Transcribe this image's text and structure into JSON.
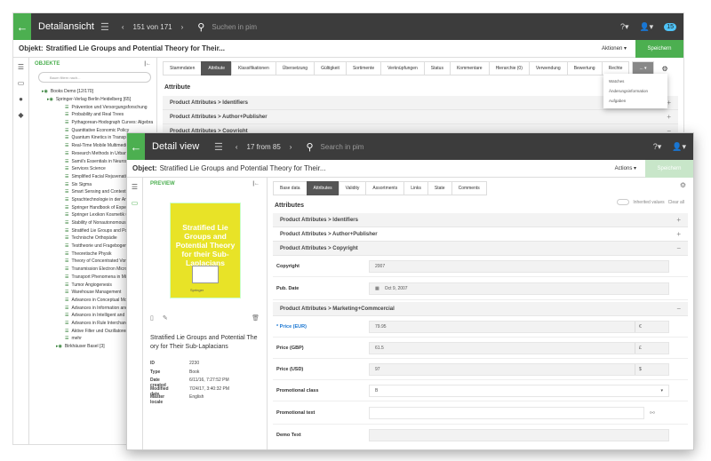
{
  "back_win": {
    "title": "Detailansicht",
    "pager": "151 von 171",
    "search_placeholder": "Suchen in pim",
    "badge": "15",
    "object_label": "Objekt:",
    "object_value": "Stratified Lie Groups and Potential Theory for Their...",
    "actions": "Aktionen ▾",
    "save": "Speichern",
    "tree_title": "OBJEKTE",
    "filter_placeholder": "Baum filtern nach...",
    "tree": [
      "Books Demo [12/170]",
      "Springer-Verlag Berlin Heidelberg [65]",
      "Prävention und Versorgungsforschung",
      "Probability and Real Trees",
      "Pythagorean-Hodograph Curves: Algebra",
      "Quantitative Economic Policy",
      "Quantum Kinetics in Transport",
      "Real-Time Mobile Multimedia",
      "Research Methods in Urban and",
      "Samii's Essentials in Neurosurgery",
      "Services Science",
      "Simplified Facial Rejuvenation",
      "Six Sigma",
      "Smart Sensing and Context",
      "Sprachtechnologie in der Anw",
      "Springer Handbook of Experim",
      "Springer Lexikon Kosmetik und",
      "Stability of Nonautonomous D",
      "Stratified Lie Groups and Pote",
      "Technische Orthopädie",
      "Testtheorie und Fragebogenkon",
      "Theoretische Physik",
      "Theory of Concentrated Vortic",
      "Transmission Electron Microsc",
      "Transport Phenomena in Micr",
      "Tumor Angiogenesis",
      "Warehouse Management",
      "Advances in Conceptual Model",
      "Advances in Information and",
      "Advances in Intelligent and Di",
      "Advances in Rule Interchange",
      "Aktive Filter und Oszillatoren",
      "mehr",
      "Birkhäuser Basel [3]"
    ],
    "tabs": [
      "Stammdaten",
      "Attribute",
      "Klassifikationen",
      "Übersetzung",
      "Gültigkeit",
      "Sortimente",
      "Verknüpfungen",
      "Status",
      "Kommentare",
      "Hierarchie (0)",
      "Verwendung",
      "Bewertung",
      "Rechte",
      "... ▾"
    ],
    "heading": "Attribute",
    "sections": [
      "Product Attributes > Identifiers",
      "Product Attributes > Author+Publisher",
      "Product Attributes > Copyright"
    ],
    "dropdown": [
      "Watches",
      "Änderungsinformation",
      "Aufgaben"
    ],
    "side_hint": "teilen"
  },
  "front_win": {
    "title": "Detail view",
    "pager": "17 from 85",
    "search_placeholder": "Search in pim",
    "object_label": "Object:",
    "object_value": "Stratified Lie Groups and Potential Theory for Their...",
    "actions": "Actions ▾",
    "save": "Speichern",
    "preview": "PREVIEW",
    "cover_title": "Stratified Lie Groups and Potential Theory for their Sub-Laplacians",
    "cover_publisher": "Springer",
    "product_title": "Stratified Lie Groups and Potential The ory for Their Sub-Laplacians",
    "meta": [
      [
        "ID",
        "2230"
      ],
      [
        "Type",
        "Book"
      ],
      [
        "Date created",
        "6/11/16, 7:27:52 PM"
      ],
      [
        "Modified date",
        "7/24/17, 3:40:32 PM"
      ],
      [
        "Master locale",
        "English"
      ]
    ],
    "tabs": [
      "Base data",
      "Attributes",
      "Validity",
      "Assortments",
      "Links",
      "State",
      "Comments"
    ],
    "heading": "Attributes",
    "inherited": "Inherited values",
    "clear": "Clear all",
    "sections": [
      "Product Attributes > Identifiers",
      "Product Attributes > Author+Publisher",
      "Product Attributes > Copyright",
      "Product Attributes > Marketing+Commcercial"
    ],
    "copyright": {
      "label": "Copyright",
      "value": "2007"
    },
    "pubdate": {
      "label": "Pub. Date",
      "value": "Oct 9, 2007"
    },
    "price_eur": {
      "label": "* Price (EUR)",
      "value": "79.95",
      "unit": "€"
    },
    "price_gbp": {
      "label": "Price (GBP)",
      "value": "61.5",
      "unit": "£"
    },
    "price_usd": {
      "label": "Price (USD)",
      "value": "97",
      "unit": "$"
    },
    "promo_class": {
      "label": "Promotional class",
      "value": "B"
    },
    "promo_text": {
      "label": "Promotional text",
      "value": ""
    },
    "demo_text": {
      "label": "Demo Text",
      "value": ""
    }
  }
}
